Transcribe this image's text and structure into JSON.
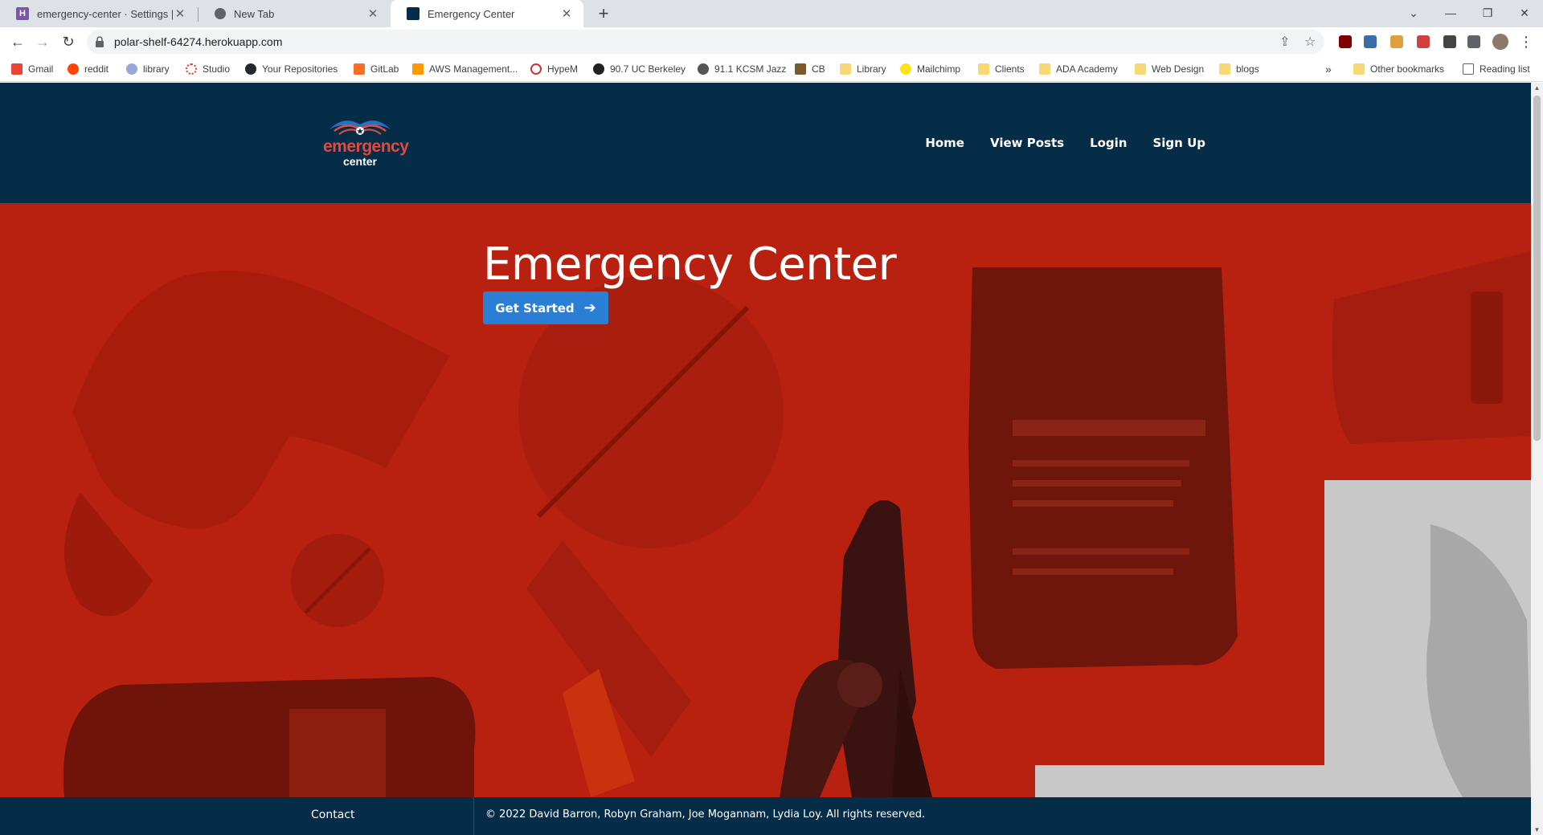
{
  "browser": {
    "tabs": [
      {
        "title": "emergency-center · Settings | He",
        "favicon": "heroku-icon",
        "active": false
      },
      {
        "title": "New Tab",
        "favicon": "chrome-icon",
        "active": false
      },
      {
        "title": "Emergency Center",
        "favicon": "emergency-center-icon",
        "active": true
      }
    ],
    "url": "polar-shelf-64274.herokuapp.com",
    "bookmarks": [
      {
        "label": "Gmail",
        "icon": "gmail-icon"
      },
      {
        "label": "reddit",
        "icon": "reddit-icon"
      },
      {
        "label": "library",
        "icon": "library-icon"
      },
      {
        "label": "Studio",
        "icon": "studio-icon"
      },
      {
        "label": "Your Repositories",
        "icon": "github-icon"
      },
      {
        "label": "GitLab",
        "icon": "gitlab-icon"
      },
      {
        "label": "AWS Management...",
        "icon": "aws-icon"
      },
      {
        "label": "HypeM",
        "icon": "hypem-icon"
      },
      {
        "label": "90.7 UC Berkeley",
        "icon": "kalx-icon"
      },
      {
        "label": "91.1 KCSM Jazz",
        "icon": "kcsm-icon"
      },
      {
        "label": "CB",
        "icon": "cb-icon"
      },
      {
        "label": "Library",
        "icon": "folder-icon"
      },
      {
        "label": "Mailchimp",
        "icon": "mailchimp-icon"
      },
      {
        "label": "Clients",
        "icon": "folder-icon"
      },
      {
        "label": "ADA Academy",
        "icon": "folder-icon"
      },
      {
        "label": "Web Design",
        "icon": "folder-icon"
      },
      {
        "label": "blogs",
        "icon": "folder-icon"
      }
    ],
    "bookmarks_overflow": "»",
    "other_bookmarks": "Other bookmarks",
    "reading_list": "Reading list"
  },
  "site": {
    "logo_word1": "emergency",
    "logo_word2": "center",
    "nav": [
      "Home",
      "View Posts",
      "Login",
      "Sign Up"
    ],
    "hero_title": "Emergency Center",
    "cta_label": "Get Started",
    "footer_contact": "Contact",
    "footer_copyright": "© 2022 David Barron, Robyn Graham, Joe Mogannam, Lydia Loy. All rights reserved."
  },
  "colors": {
    "header_bg": "#062d47",
    "hero_red": "#b8210f",
    "cta_blue": "#2a7fd4",
    "logo_red": "#e04a3f"
  }
}
